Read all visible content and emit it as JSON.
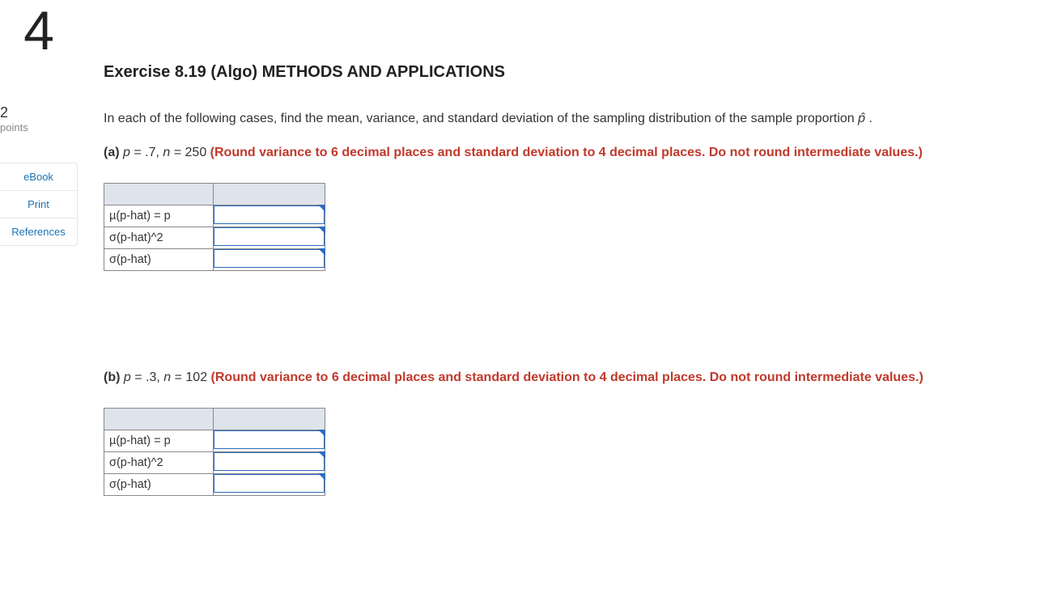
{
  "sidebar": {
    "question_number": "4",
    "points_value": "2",
    "points_label": "points",
    "links": {
      "ebook": "eBook",
      "print": "Print",
      "references": "References"
    }
  },
  "title": "Exercise 8.19 (Algo) METHODS AND APPLICATIONS",
  "intro_text": "In each of the following cases, find the mean, variance, and standard deviation of the sampling distribution of the sample proportion ",
  "phat_symbol": "p̂",
  "intro_tail": " .",
  "parts": {
    "a": {
      "label": "(a)",
      "p_lhs": "p",
      "p_eq": " = .7, ",
      "n_lhs": "n",
      "n_eq": " = 250 ",
      "instr": "(Round variance to 6 decimal places and standard deviation to 4 decimal places. Do not round intermediate values.)",
      "rows": {
        "mu": "µ(p-hat) = p",
        "var": "σ(p-hat)^2",
        "sd": "σ(p-hat)"
      },
      "inputs": {
        "mu": "",
        "var": "",
        "sd": ""
      }
    },
    "b": {
      "label": "(b)",
      "p_lhs": "p",
      "p_eq": " = .3, ",
      "n_lhs": "n",
      "n_eq": " = 102 ",
      "instr": "(Round variance to 6 decimal places and standard deviation to 4 decimal places. Do not round intermediate values.)",
      "rows": {
        "mu": "µ(p-hat) = p",
        "var": "σ(p-hat)^2",
        "sd": "σ(p-hat)"
      },
      "inputs": {
        "mu": "",
        "var": "",
        "sd": ""
      }
    }
  }
}
